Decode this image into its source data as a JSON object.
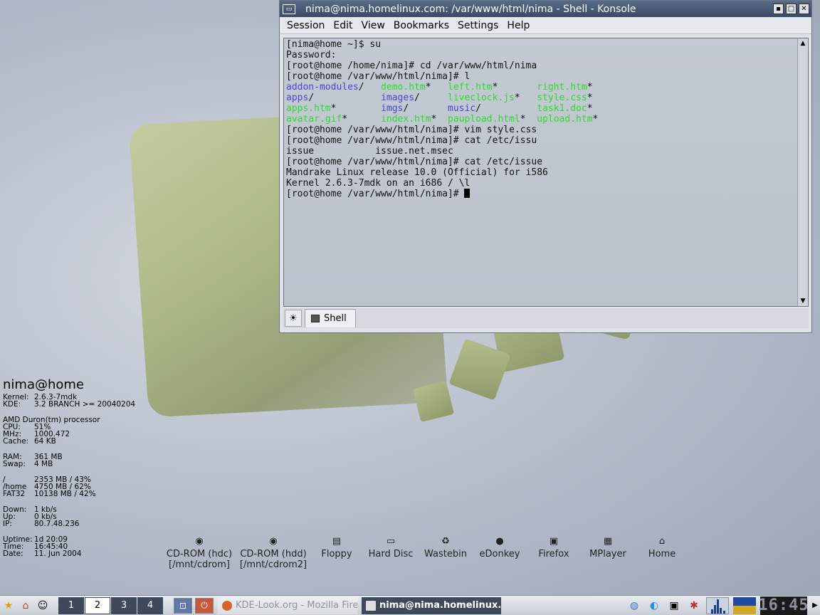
{
  "sysinfo": {
    "title": "nima@home",
    "rows1": [
      {
        "k": "Kernel:",
        "v": "2.6.3-7mdk"
      },
      {
        "k": "KDE:",
        "v": "3.2 BRANCH >= 20040204"
      }
    ],
    "processor": "AMD Duron(tm) processor",
    "rows2": [
      {
        "k": "CPU:",
        "v": "51%"
      },
      {
        "k": "MHz:",
        "v": "1000.472"
      },
      {
        "k": "Cache:",
        "v": "64 KB"
      }
    ],
    "rows3": [
      {
        "k": "RAM:",
        "v": "361 MB"
      },
      {
        "k": "Swap:",
        "v": "4 MB"
      }
    ],
    "rows4": [
      {
        "k": "/",
        "v": "2353 MB / 43%"
      },
      {
        "k": "/home",
        "v": "4750 MB / 62%"
      },
      {
        "k": "FAT32",
        "v": "10138 MB / 42%"
      }
    ],
    "rows5": [
      {
        "k": "Down:",
        "v": "1 kb/s"
      },
      {
        "k": "Up:",
        "v": "0 kb/s"
      },
      {
        "k": "IP:",
        "v": "80.7.48.236"
      }
    ],
    "rows6": [
      {
        "k": "Uptime:",
        "v": "1d 20:09"
      },
      {
        "k": "Time:",
        "v": "16:45:40"
      },
      {
        "k": "Date:",
        "v": "11. Jun 2004"
      }
    ]
  },
  "desktop_icons": [
    {
      "label": "CD-ROM (hdc)\n[/mnt/cdrom]",
      "icon": "cdrom-icon",
      "glyph": "◉"
    },
    {
      "label": "CD-ROM (hdd)\n[/mnt/cdrom2]",
      "icon": "cdrom-icon",
      "glyph": "◉"
    },
    {
      "label": "Floppy",
      "icon": "floppy-icon",
      "glyph": "▤"
    },
    {
      "label": "Hard Disc",
      "icon": "harddisk-icon",
      "glyph": "▭"
    },
    {
      "label": "Wastebin",
      "icon": "trash-icon",
      "glyph": "♻"
    },
    {
      "label": "eDonkey",
      "icon": "edonkey-icon",
      "glyph": "●"
    },
    {
      "label": "Firefox",
      "icon": "firefox-icon",
      "glyph": "▣"
    },
    {
      "label": "MPlayer",
      "icon": "mplayer-icon",
      "glyph": "▦"
    },
    {
      "label": "Home",
      "icon": "home-icon",
      "glyph": "⌂"
    }
  ],
  "window": {
    "title": "nima@nima.homelinux.com: /var/www/html/nima - Shell - Konsole",
    "menu": [
      "Session",
      "Edit",
      "View",
      "Bookmarks",
      "Settings",
      "Help"
    ],
    "tab_label": "Shell"
  },
  "terminal": {
    "lines": [
      [
        {
          "t": "[nima@home ~]$ su"
        }
      ],
      [
        {
          "t": "Password:"
        }
      ],
      [
        {
          "t": "[root@home /home/nima]# cd /var/www/html/nima"
        }
      ],
      [
        {
          "t": "[root@home /var/www/html/nima]# l"
        }
      ],
      [
        {
          "t": "addon-modules",
          "c": "blue"
        },
        {
          "t": "/   "
        },
        {
          "t": "demo.htm",
          "c": "green"
        },
        {
          "t": "*   "
        },
        {
          "t": "left.htm",
          "c": "green"
        },
        {
          "t": "*       "
        },
        {
          "t": "right.htm",
          "c": "green"
        },
        {
          "t": "*"
        }
      ],
      [
        {
          "t": "apps",
          "c": "blue"
        },
        {
          "t": "/            "
        },
        {
          "t": "images",
          "c": "blue"
        },
        {
          "t": "/     "
        },
        {
          "t": "liveclock.js",
          "c": "green"
        },
        {
          "t": "*   "
        },
        {
          "t": "style.css",
          "c": "green"
        },
        {
          "t": "*"
        }
      ],
      [
        {
          "t": "apps.htm",
          "c": "green"
        },
        {
          "t": "*        "
        },
        {
          "t": "imgs",
          "c": "blue"
        },
        {
          "t": "/       "
        },
        {
          "t": "music",
          "c": "blue"
        },
        {
          "t": "/          "
        },
        {
          "t": "task1.doc",
          "c": "green"
        },
        {
          "t": "*"
        }
      ],
      [
        {
          "t": "avatar.gif",
          "c": "green"
        },
        {
          "t": "*      "
        },
        {
          "t": "index.htm",
          "c": "green"
        },
        {
          "t": "*  "
        },
        {
          "t": "paupload.html",
          "c": "green"
        },
        {
          "t": "*  "
        },
        {
          "t": "upload.htm",
          "c": "green"
        },
        {
          "t": "*"
        }
      ],
      [
        {
          "t": "[root@home /var/www/html/nima]# vim style.css"
        }
      ],
      [
        {
          "t": "[root@home /var/www/html/nima]# cat /etc/issu"
        }
      ],
      [
        {
          "t": "issue           issue.net.msec"
        }
      ],
      [
        {
          "t": "[root@home /var/www/html/nima]# cat /etc/issue"
        }
      ],
      [
        {
          "t": "Mandrake Linux release 10.0 (Official) for i586"
        }
      ],
      [
        {
          "t": "Kernel 2.6.3-7mdk on an i686 / \\l"
        }
      ],
      [
        {
          "t": "[root@home /var/www/html/nima]# "
        }
      ]
    ]
  },
  "taskbar": {
    "desktops": [
      "1",
      "2",
      "3",
      "4"
    ],
    "active_desktop": 1,
    "tasks": [
      {
        "label": "KDE-Look.org - Mozilla Fire",
        "active": false,
        "icon": "mozilla-icon"
      },
      {
        "label": "nima@nima.homelinux.",
        "active": true,
        "icon": "konsole-icon"
      }
    ],
    "clock": "16:45"
  }
}
